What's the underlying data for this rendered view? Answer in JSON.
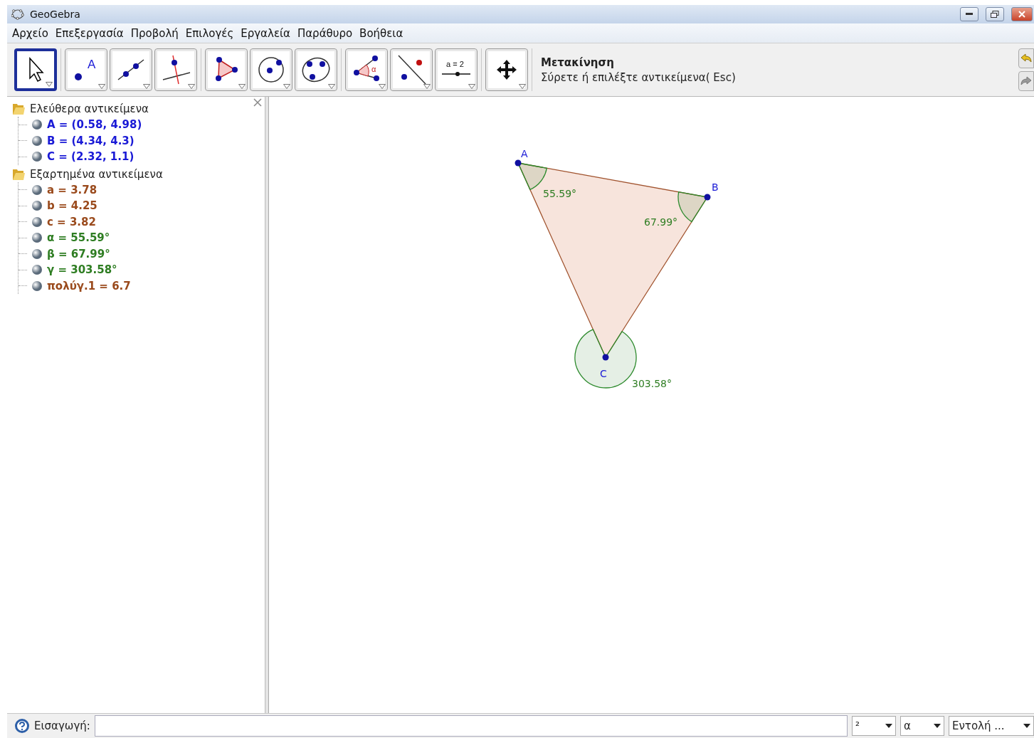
{
  "window": {
    "title": "GeoGebra"
  },
  "menu": [
    "Αρχείο",
    "Επεξεργασία",
    "Προβολή",
    "Επιλογές",
    "Εργαλεία",
    "Παράθυρο",
    "Βοήθεια"
  ],
  "toolbar": {
    "groups": [
      [
        {
          "kind": "move",
          "selected": true
        }
      ],
      [
        {
          "kind": "point",
          "selected": false,
          "text": "A"
        },
        {
          "kind": "line",
          "selected": false
        },
        {
          "kind": "perpendicular",
          "selected": false
        }
      ],
      [
        {
          "kind": "polygon",
          "selected": false
        },
        {
          "kind": "circle",
          "selected": false
        },
        {
          "kind": "conic",
          "selected": false
        }
      ],
      [
        {
          "kind": "angle",
          "selected": false,
          "text": "α"
        },
        {
          "kind": "reflect",
          "selected": false
        },
        {
          "kind": "slider",
          "selected": false,
          "text": "a = 2"
        }
      ],
      [
        {
          "kind": "pan",
          "selected": false
        }
      ]
    ],
    "tool_name": "Μετακίνηση",
    "tool_help": "Σύρετε ή επιλέξτε αντικείμενα( Esc)"
  },
  "algebra": {
    "groups": [
      {
        "label": "Ελεύθερα αντικείμενα",
        "expanded": true,
        "children": [
          {
            "text": "A = (0.58, 4.98)",
            "color": "#1a1ad6"
          },
          {
            "text": "B = (4.34, 4.3)",
            "color": "#1a1ad6"
          },
          {
            "text": "C = (2.32, 1.1)",
            "color": "#1a1ad6"
          }
        ]
      },
      {
        "label": "Εξαρτημένα αντικείμενα",
        "expanded": true,
        "children": [
          {
            "text": "a = 3.78",
            "color": "#9a4a1c"
          },
          {
            "text": "b = 4.25",
            "color": "#9a4a1c"
          },
          {
            "text": "c = 3.82",
            "color": "#9a4a1c"
          },
          {
            "text": "α = 55.59°",
            "color": "#2e7d22"
          },
          {
            "text": "β = 67.99°",
            "color": "#2e7d22"
          },
          {
            "text": "γ = 303.58°",
            "color": "#2e7d22"
          },
          {
            "text": "πολύγ.1 = 6.7",
            "color": "#9a4a1c"
          }
        ]
      }
    ]
  },
  "canvas": {
    "points": [
      {
        "label": "A"
      },
      {
        "label": "B"
      },
      {
        "label": "C"
      }
    ],
    "angles": [
      {
        "label": "55.59°",
        "reflex": false
      },
      {
        "label": "67.99°",
        "reflex": false
      },
      {
        "label": "303.58°",
        "reflex": true
      }
    ]
  },
  "input_bar": {
    "label": "Εισαγωγή:",
    "dropdowns": [
      "²",
      "α",
      "Εντολή ..."
    ]
  }
}
